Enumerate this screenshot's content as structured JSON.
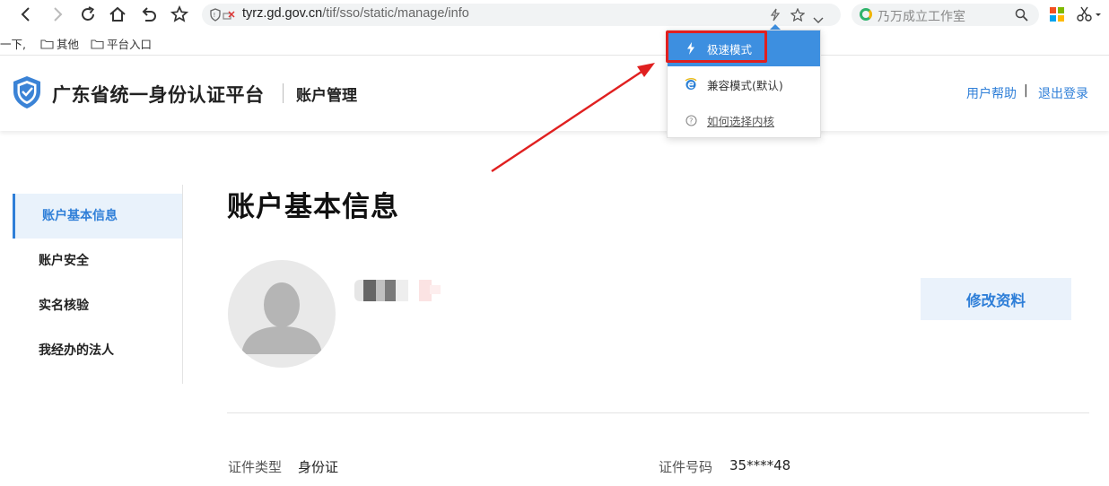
{
  "browser": {
    "url_host": "tyrz.gd.gov.cn",
    "url_path": "/tif/sso/static/manage/info",
    "search_text": "乃万成立工作室",
    "bookmarks": [
      "一下,",
      "其他",
      "平台入口"
    ]
  },
  "dropdown": {
    "items": [
      {
        "label": "极速模式"
      },
      {
        "label": "兼容模式(默认)"
      },
      {
        "label": "如何选择内核"
      }
    ]
  },
  "header": {
    "platform_name": "广东省统一身份认证平台",
    "section_name": "账户管理",
    "help_link": "用户帮助",
    "separator": "|",
    "logout_link": "退出登录"
  },
  "sidebar": {
    "items": [
      {
        "label": "账户基本信息"
      },
      {
        "label": "账户安全"
      },
      {
        "label": "实名核验"
      },
      {
        "label": "我经办的法人"
      }
    ]
  },
  "main": {
    "title": "账户基本信息",
    "edit_button": "修改资料",
    "fields": [
      {
        "label": "证件类型",
        "value": "身份证"
      },
      {
        "label": "证件号码",
        "value": "35****48"
      }
    ]
  },
  "colors": {
    "accent": "#2f7fd8",
    "dropdown_selected": "#3d8fe0",
    "annotation": "#e02020"
  }
}
